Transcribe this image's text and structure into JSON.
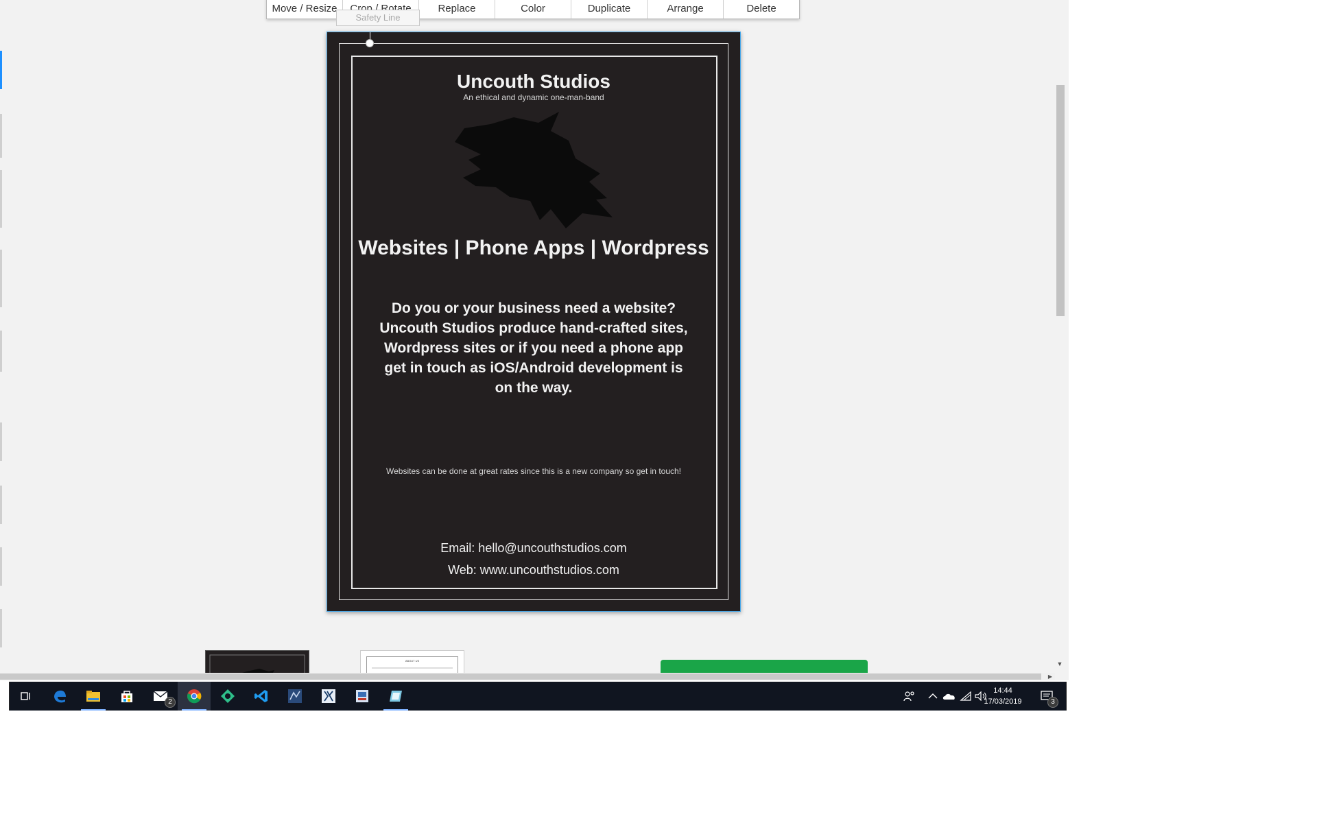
{
  "toolbar": {
    "buttons": [
      {
        "label": "Move / Resize"
      },
      {
        "label": "Crop / Rotate"
      },
      {
        "label": "Replace"
      },
      {
        "label": "Color"
      },
      {
        "label": "Duplicate"
      },
      {
        "label": "Arrange"
      },
      {
        "label": "Delete"
      }
    ]
  },
  "bleed_label": "Safety Line",
  "flyer": {
    "title": "Uncouth Studios",
    "subtitle": "An ethical and dynamic one-man-band",
    "headline": "Websites | Phone Apps | Wordpress",
    "pitch": "Do you or your business need a website? Uncouth Studios produce hand-crafted sites, Wordpress sites or if you need a phone app get in touch as iOS/Android development is on the way.",
    "note": "Websites can be done at great rates since this is a new company so get in touch!",
    "email": "Email: hello@uncouthstudios.com",
    "web": "Web: www.uncouthstudios.com"
  },
  "thumbnail2_text": "ABOUT US",
  "taskbar": {
    "apps": [
      {
        "name": "task-view-icon"
      },
      {
        "name": "edge-icon"
      },
      {
        "name": "file-explorer-icon"
      },
      {
        "name": "store-icon"
      },
      {
        "name": "mail-icon",
        "badge": "2"
      },
      {
        "name": "chrome-icon"
      },
      {
        "name": "gitkraken-icon"
      },
      {
        "name": "vscode-icon"
      },
      {
        "name": "sql-icon"
      },
      {
        "name": "xcode-icon"
      },
      {
        "name": "remote-icon"
      },
      {
        "name": "paint-icon"
      }
    ],
    "clock_time": "14:44",
    "clock_date": "17/03/2019",
    "notification_count": "3"
  },
  "colors": {
    "flyer_bg": "#231f20",
    "accent_green": "#1aa548",
    "selection_blue": "#4aa8e8",
    "taskbar_bg": "#101520"
  }
}
